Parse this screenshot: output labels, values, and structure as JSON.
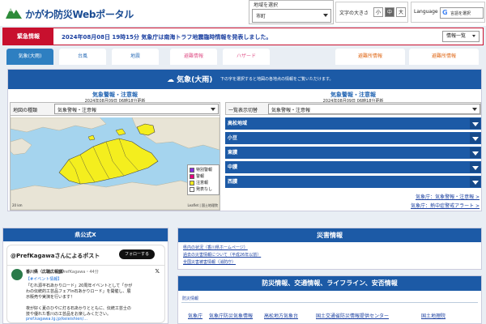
{
  "header": {
    "site_title": "かがわ防災Webポータル",
    "region_label": "地域を選択",
    "region_value": "市町",
    "fontsize_label": "文字の大きさ",
    "fontsize_options": [
      "小",
      "中",
      "大"
    ],
    "language_label": "Language",
    "language_value": "言語を選択"
  },
  "alert": {
    "label": "緊急情報",
    "text": "2024年08月08日 19時15分 気象庁は南海トラフ地震臨時情報を発表しました。",
    "list_button": "情報一覧"
  },
  "tabs": [
    {
      "label": "気象(大雨)"
    },
    {
      "label": "台風"
    },
    {
      "label": "地震"
    },
    {
      "label": "避難情報"
    },
    {
      "label": "ハザード"
    },
    {
      "label": "避難所情報"
    },
    {
      "label": "避難所情報"
    }
  ],
  "weather": {
    "title": "気象(大雨)",
    "note": "下の字を選択すると地図の各地点の情報をご覧いただけます。",
    "left_subtitle": "気象警報・注意報",
    "left_time": "2024年08月09日 06時18分更新",
    "right_subtitle": "気象警報・注意報",
    "right_time": "2024年08月09日 06時18分更新",
    "map_select_label": "地図の種類",
    "map_select_value": "気象警報・注意報",
    "legend": [
      {
        "label": "特別警報",
        "color": "#8a2be2"
      },
      {
        "label": "警報",
        "color": "#e6007e"
      },
      {
        "label": "注意報",
        "color": "#f2ea1f"
      },
      {
        "label": "発表なし",
        "color": "#ffffff"
      }
    ],
    "scale": "20 km",
    "attribution": "Leaflet | 国土地理院",
    "list_select_label": "一覧表示切替",
    "list_select_value": "気象警報・注意報",
    "areas": [
      "高松地域",
      "小豆",
      "東讃",
      "中讃",
      "西讃"
    ],
    "jma_link_1": "気象庁：気象警報・注意報 >",
    "jma_link_2": "気象庁：熱中症警戒アラート >"
  },
  "x_panel": {
    "header": "県公式X",
    "title": "@PrefKagawaさんによるポスト",
    "follow": "フォローする",
    "name": "香川県（広聴広報課）",
    "handle": "@PrefKagawa・44分",
    "lines": [
      "【#イベント情報】",
      "「むれ源平石あかりロード」20周年イベントとして「かが",
      "わの伝統的工芸品フェアin石あかりロード」を開催し、展",
      "示販売や実演を行います！",
      "",
      "夜が好く夏のひやに灯る石あかりとともに、伝統工芸士の",
      "技や優れた香川の工芸品をお楽しみください。",
      "pref.kagawa.lg.jp/keieishien/..."
    ]
  },
  "disaster": {
    "header": "災害情報",
    "links": [
      "県内の状況（香川県ホームページ）",
      "過去の災害情報について（平成26年以前）",
      "全国災害被害情報（消防庁）"
    ]
  },
  "safety": {
    "header": "防災情報、交通情報、ライフライン、安否情報",
    "sub": "防災情報",
    "links": [
      "気象庁",
      "気象庁防災気象情報",
      "高松地方気象台",
      "国土交通省防災情報提供センター",
      "国土地理院"
    ]
  }
}
